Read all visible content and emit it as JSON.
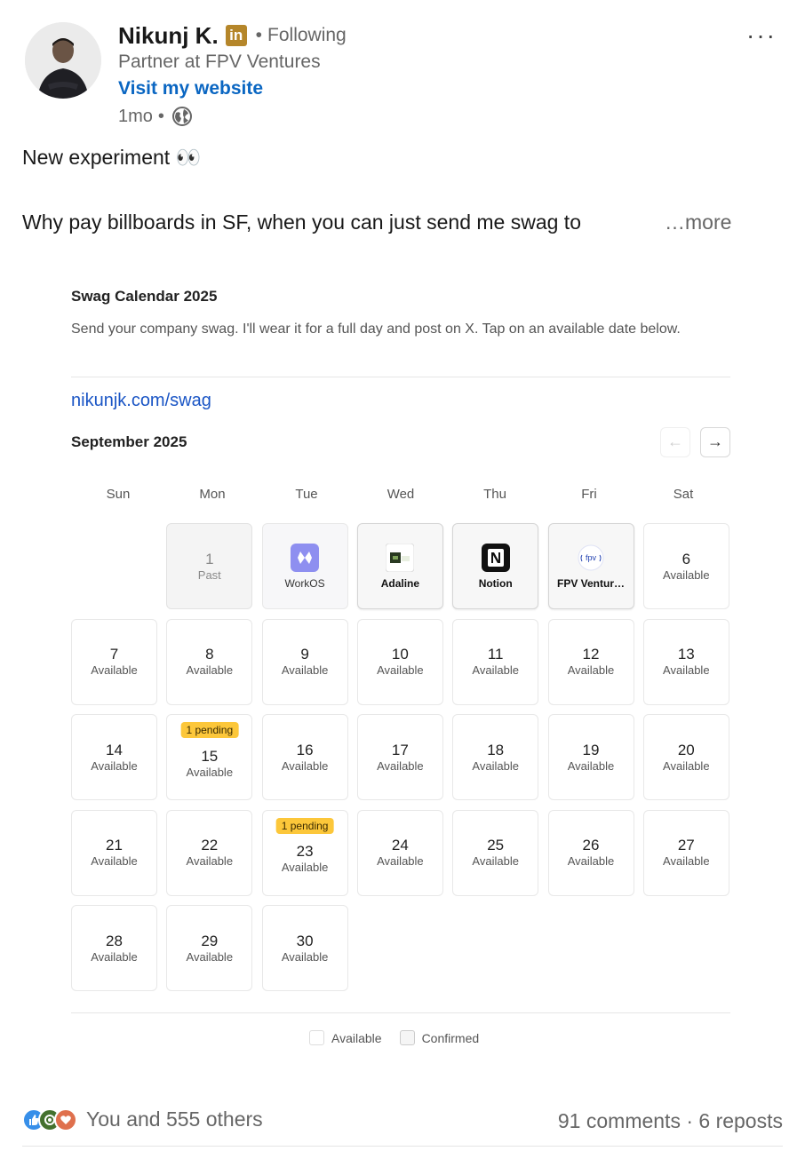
{
  "author": {
    "name": "Nikunj K.",
    "badge": "in",
    "following": "Following",
    "headline": "Partner at FPV Ventures",
    "website_label": "Visit my website",
    "time": "1mo"
  },
  "post": {
    "line1": "New experiment 👀",
    "line2": "Why pay billboards in SF, when you can just send me swag to",
    "more": "…more"
  },
  "card": {
    "title": "Swag Calendar 2025",
    "description": "Send your company swag. I'll wear it for a full day and post on X. Tap on an available date below.",
    "link": "nikunjk.com/swag",
    "month": "September 2025",
    "prev": "←",
    "next": "→",
    "weekdays": [
      "Sun",
      "Mon",
      "Tue",
      "Wed",
      "Thu",
      "Fri",
      "Sat"
    ],
    "days": [
      {
        "num": "1",
        "status": "Past",
        "type": "past"
      },
      {
        "name": "WorkOS",
        "type": "logo",
        "logo": "workos-logo"
      },
      {
        "name": "Adaline",
        "type": "booked",
        "logo": "adaline-logo"
      },
      {
        "name": "Notion",
        "type": "booked",
        "logo": "notion-logo"
      },
      {
        "name": "FPV Ventur…",
        "type": "booked",
        "logo": "fpv-logo"
      },
      {
        "num": "6",
        "status": "Available"
      },
      {
        "num": "7",
        "status": "Available"
      },
      {
        "num": "8",
        "status": "Available"
      },
      {
        "num": "9",
        "status": "Available"
      },
      {
        "num": "10",
        "status": "Available"
      },
      {
        "num": "11",
        "status": "Available"
      },
      {
        "num": "12",
        "status": "Available"
      },
      {
        "num": "13",
        "status": "Available"
      },
      {
        "num": "14",
        "status": "Available"
      },
      {
        "num": "15",
        "status": "Available",
        "badge": "1 pending"
      },
      {
        "num": "16",
        "status": "Available"
      },
      {
        "num": "17",
        "status": "Available"
      },
      {
        "num": "18",
        "status": "Available"
      },
      {
        "num": "19",
        "status": "Available"
      },
      {
        "num": "20",
        "status": "Available"
      },
      {
        "num": "21",
        "status": "Available"
      },
      {
        "num": "22",
        "status": "Available"
      },
      {
        "num": "23",
        "status": "Available",
        "badge": "1 pending"
      },
      {
        "num": "24",
        "status": "Available"
      },
      {
        "num": "25",
        "status": "Available"
      },
      {
        "num": "26",
        "status": "Available"
      },
      {
        "num": "27",
        "status": "Available"
      },
      {
        "num": "28",
        "status": "Available"
      },
      {
        "num": "29",
        "status": "Available"
      },
      {
        "num": "30",
        "status": "Available"
      }
    ],
    "legend": {
      "available": "Available",
      "confirmed": "Confirmed"
    }
  },
  "social": {
    "reactions_text": "You and 555 others",
    "counts": "91 comments · 6 reposts"
  },
  "colors": {
    "link": "#0a66c2",
    "pending": "#fcc73a",
    "badge": "#b5862a"
  }
}
